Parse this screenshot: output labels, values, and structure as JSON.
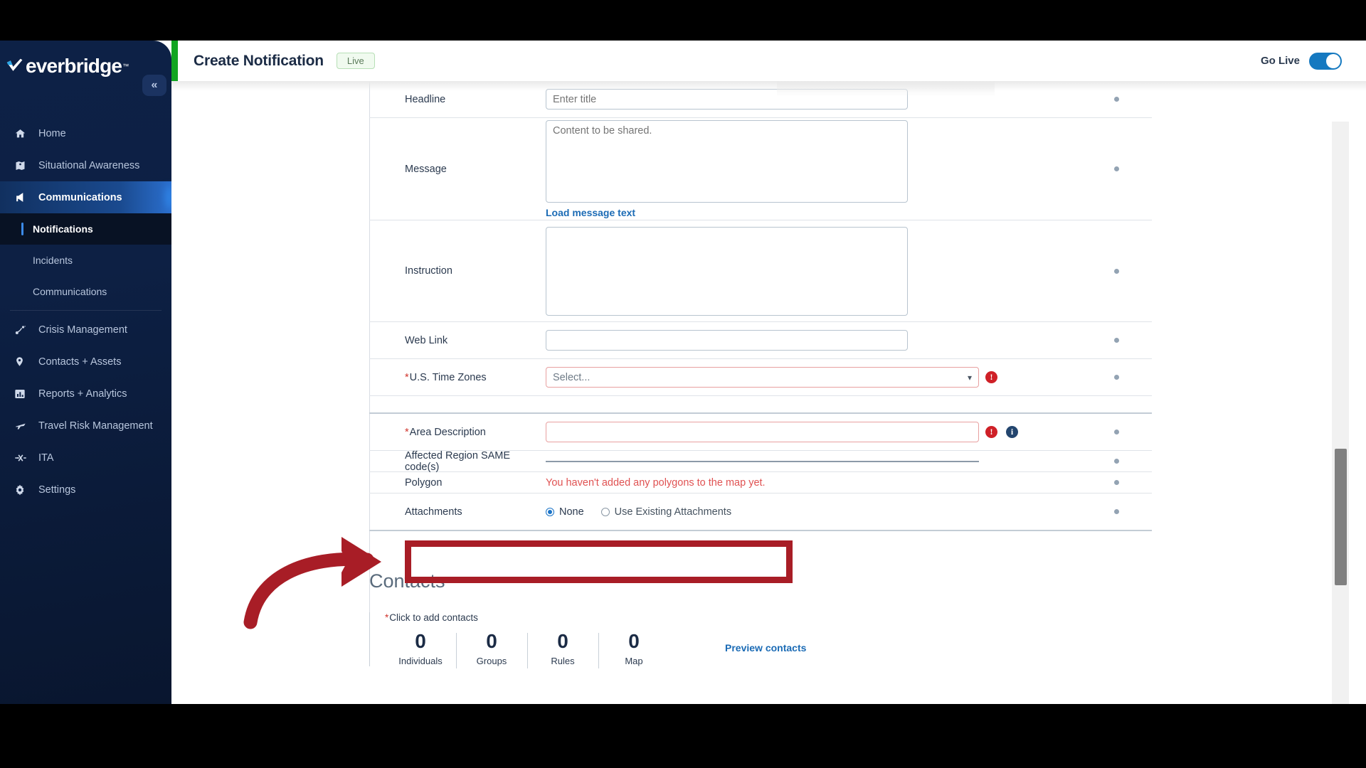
{
  "brand": {
    "name": "everbridge",
    "tm": "™",
    "accent_green": "#12a521",
    "accent_blue": "#2b6fce"
  },
  "sidebar": {
    "collapse_icon": "chevron-double-left",
    "items": [
      {
        "label": "Home",
        "icon": "home-icon",
        "state": "normal"
      },
      {
        "label": "Situational Awareness",
        "icon": "situational-awareness-icon",
        "state": "normal"
      },
      {
        "label": "Communications",
        "icon": "megaphone-icon",
        "state": "active"
      },
      {
        "label": "Notifications",
        "icon": "",
        "state": "sub-selected"
      },
      {
        "label": "Incidents",
        "icon": "",
        "state": "sub"
      },
      {
        "label": "Communications",
        "icon": "",
        "state": "sub"
      },
      {
        "label": "Crisis Management",
        "icon": "crisis-management-icon",
        "state": "normal"
      },
      {
        "label": "Contacts + Assets",
        "icon": "location-pin-icon",
        "state": "normal"
      },
      {
        "label": "Reports + Analytics",
        "icon": "bar-chart-icon",
        "state": "normal"
      },
      {
        "label": "Travel Risk Management",
        "icon": "airplane-icon",
        "state": "normal"
      },
      {
        "label": "ITA",
        "icon": "ita-icon",
        "state": "normal"
      },
      {
        "label": "Settings",
        "icon": "gear-icon",
        "state": "normal"
      }
    ]
  },
  "topbar": {
    "title": "Create Notification",
    "badge": "Live",
    "go_live_label": "Go Live",
    "go_live_on": true
  },
  "form": {
    "headline": {
      "label": "Headline",
      "placeholder": "Enter title",
      "value": ""
    },
    "message": {
      "label": "Message",
      "placeholder": "Content to be shared.",
      "value": "",
      "link": "Load message text"
    },
    "instruction": {
      "label": "Instruction",
      "placeholder": "",
      "value": ""
    },
    "web_link": {
      "label": "Web Link",
      "placeholder": "",
      "value": ""
    },
    "time_zones": {
      "label": "U.S. Time Zones",
      "required": "*",
      "value": "Select...",
      "error": true
    },
    "area_description": {
      "label": "Area Description",
      "required": "*",
      "value": "",
      "error": true
    },
    "same_codes": {
      "label": "Affected Region SAME code(s)"
    },
    "polygon": {
      "label": "Polygon",
      "message": "You haven't added any polygons to the map yet."
    },
    "attachments": {
      "label": "Attachments",
      "options": [
        {
          "label": "None",
          "selected": true
        },
        {
          "label": "Use Existing Attachments",
          "selected": false
        }
      ]
    }
  },
  "contacts": {
    "heading": "Contacts",
    "required": "*",
    "hint": "Click to add contacts",
    "counters": [
      {
        "value": "0",
        "label": "Individuals"
      },
      {
        "value": "0",
        "label": "Groups"
      },
      {
        "value": "0",
        "label": "Rules"
      },
      {
        "value": "0",
        "label": "Map"
      }
    ],
    "preview_link": "Preview contacts"
  },
  "annotation": {
    "color": "#a81d26",
    "arrow": "curved-right-arrow",
    "highlight_target": "attachments-row"
  }
}
